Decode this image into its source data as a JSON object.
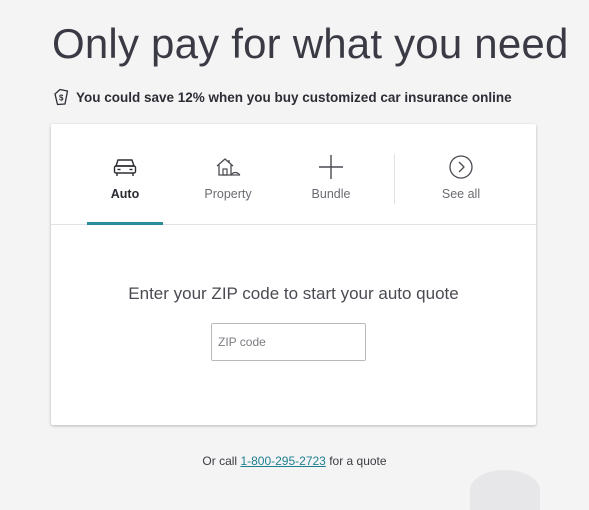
{
  "headline": "Only pay for what you need",
  "savings": {
    "icon": "price-tag-icon",
    "text": "You could save 12% when you buy customized car insurance online"
  },
  "tabs": [
    {
      "label": "Auto",
      "icon": "car-icon",
      "active": true
    },
    {
      "label": "Property",
      "icon": "house-icon",
      "active": false
    },
    {
      "label": "Bundle",
      "icon": "plus-icon",
      "active": false
    },
    {
      "label": "See all",
      "icon": "chevron-right-circle-icon",
      "active": false
    }
  ],
  "quote": {
    "prompt": "Enter your ZIP code to start your auto quote",
    "zip_placeholder": "ZIP code",
    "zip_value": ""
  },
  "call": {
    "prefix": "Or call",
    "phone": "1-800-295-2723",
    "suffix": "for a quote"
  },
  "colors": {
    "accent": "#2c8c9a",
    "link": "#1f7f8f",
    "background": "#f4f4f5"
  }
}
